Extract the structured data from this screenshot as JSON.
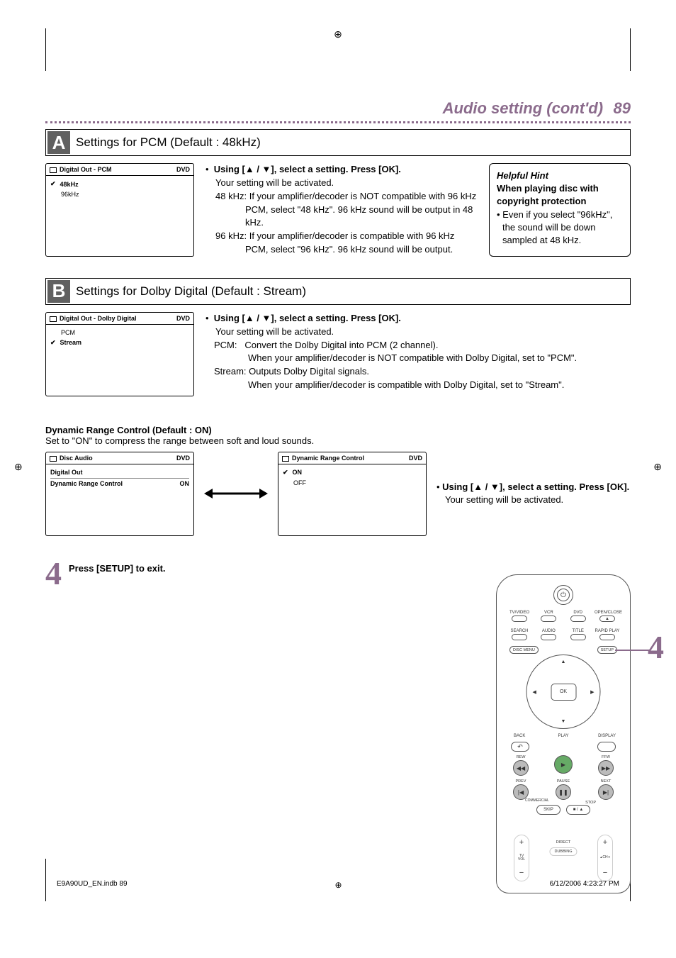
{
  "header": {
    "title": "Audio setting (cont'd)",
    "page": "89"
  },
  "sectionA": {
    "letter": "A",
    "title": "Settings for PCM (Default : 48kHz)",
    "osd": {
      "header": "Digital Out - PCM",
      "tag": "DVD",
      "items": [
        "48kHz",
        "96kHz"
      ]
    },
    "bullet": "Using [▲ / ▼], select a setting. Press [OK].",
    "activated": "Your setting will be activated.",
    "r1_label": "48 kHz:",
    "r1_text": "If your amplifier/decoder is NOT compatible with 96 kHz PCM, select \"48 kHz\". 96 kHz sound will be output in 48 kHz.",
    "r2_label": "96 kHz:",
    "r2_text": "If your amplifier/decoder is compatible with 96 kHz PCM, select \"96 kHz\". 96 kHz sound will be output."
  },
  "hint": {
    "title": "Helpful Hint",
    "line1": "When playing disc with copyright protection",
    "line2": "Even if you select \"96kHz\", the sound will be down sampled at 48 kHz."
  },
  "sectionB": {
    "letter": "B",
    "title": "Settings for Dolby Digital (Default : Stream)",
    "osd": {
      "header": "Digital Out - Dolby Digital",
      "tag": "DVD",
      "items": [
        "PCM",
        "Stream"
      ]
    },
    "bullet": "Using [▲ / ▼], select a setting. Press [OK].",
    "activated": "Your setting will be activated.",
    "r1_label": "PCM:",
    "r1_text1": "Convert the Dolby Digital into PCM (2 channel).",
    "r1_text2": "When your amplifier/decoder is NOT compatible with Dolby Digital, set to \"PCM\".",
    "r2_label": "Stream:",
    "r2_text1": "Outputs Dolby Digital signals.",
    "r2_text2": "When your amplifier/decoder is compatible with Dolby Digital, set to \"Stream\"."
  },
  "drc": {
    "heading": "Dynamic Range Control (Default : ON)",
    "sub": "Set to \"ON\" to compress the range between soft and loud sounds.",
    "osd1": {
      "header": "Disc Audio",
      "tag": "DVD",
      "row1_l": "Digital Out",
      "row2_l": "Dynamic Range Control",
      "row2_r": "ON"
    },
    "osd2": {
      "header": "Dynamic Range Control",
      "tag": "DVD",
      "items": [
        "ON",
        "OFF"
      ]
    },
    "bullet": "Using [▲ / ▼], select a setting. Press [OK].",
    "activated": "Your setting will be activated."
  },
  "step4": {
    "num": "4",
    "text": "Press [SETUP] to exit."
  },
  "remote": {
    "row1": [
      "TV/VIDEO",
      "VCR",
      "DVD",
      "OPEN/CLOSE"
    ],
    "row2": [
      "SEARCH",
      "AUDIO",
      "TITLE",
      "RAPID PLAY"
    ],
    "disc_menu": "DISC MENU",
    "setup": "SETUP",
    "ok": "OK",
    "back": "BACK",
    "display": "DISPLAY",
    "play": "PLAY",
    "rew": "REW",
    "ffw": "FFW",
    "prev": "PREV",
    "pause": "PAUSE",
    "next": "NEXT",
    "commercial": "COMMERCIAL",
    "stop": "STOP",
    "skip_l": "SKIP",
    "dubbing_lbl": "DIRECT",
    "dubbing": "DUBBING",
    "tv_vol": "TV\nVOL",
    "ch": "CH",
    "callout": "4"
  },
  "footer": {
    "left": "E9A90UD_EN.indb   89",
    "right": "6/12/2006   4:23:27 PM"
  }
}
